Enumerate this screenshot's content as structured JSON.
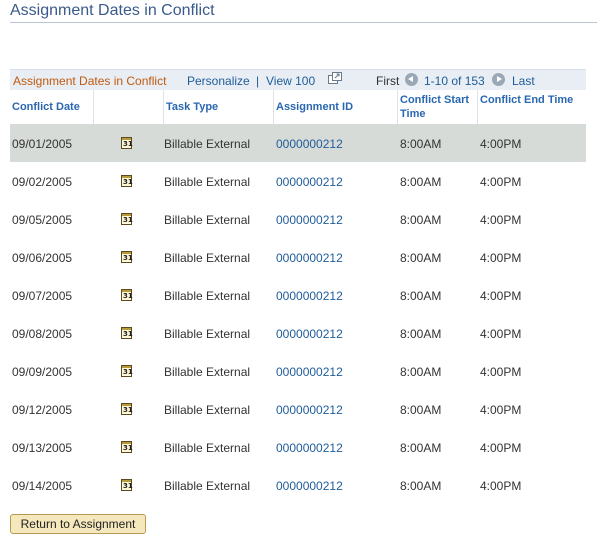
{
  "page": {
    "title": "Assignment Dates in Conflict"
  },
  "grid": {
    "caption": "Assignment Dates in Conflict",
    "personalize": "Personalize",
    "separator": "|",
    "view_all": "View 100",
    "first": "First",
    "range": "1-10 of 153",
    "last": "Last",
    "columns": {
      "conflict_date": "Conflict Date",
      "task_type": "Task Type",
      "assignment_id": "Assignment ID",
      "start_time": "Conflict Start Time",
      "end_time": "Conflict End Time"
    },
    "calendar_glyph": "31",
    "rows": [
      {
        "date": "09/01/2005",
        "task": "Billable External",
        "aid": "0000000212",
        "start": "8:00AM",
        "end": "4:00PM"
      },
      {
        "date": "09/02/2005",
        "task": "Billable External",
        "aid": "0000000212",
        "start": "8:00AM",
        "end": "4:00PM"
      },
      {
        "date": "09/05/2005",
        "task": "Billable External",
        "aid": "0000000212",
        "start": "8:00AM",
        "end": "4:00PM"
      },
      {
        "date": "09/06/2005",
        "task": "Billable External",
        "aid": "0000000212",
        "start": "8:00AM",
        "end": "4:00PM"
      },
      {
        "date": "09/07/2005",
        "task": "Billable External",
        "aid": "0000000212",
        "start": "8:00AM",
        "end": "4:00PM"
      },
      {
        "date": "09/08/2005",
        "task": "Billable External",
        "aid": "0000000212",
        "start": "8:00AM",
        "end": "4:00PM"
      },
      {
        "date": "09/09/2005",
        "task": "Billable External",
        "aid": "0000000212",
        "start": "8:00AM",
        "end": "4:00PM"
      },
      {
        "date": "09/12/2005",
        "task": "Billable External",
        "aid": "0000000212",
        "start": "8:00AM",
        "end": "4:00PM"
      },
      {
        "date": "09/13/2005",
        "task": "Billable External",
        "aid": "0000000212",
        "start": "8:00AM",
        "end": "4:00PM"
      },
      {
        "date": "09/14/2005",
        "task": "Billable External",
        "aid": "0000000212",
        "start": "8:00AM",
        "end": "4:00PM"
      }
    ]
  },
  "buttons": {
    "return": "Return to Assignment"
  },
  "colors": {
    "title": "#3a5a8a",
    "caption": "#c05a10",
    "link": "#1f5c99",
    "selected_row": "#d7dbd8",
    "button_bg": "#f5e8bc"
  },
  "icons": {
    "zoom": "grid-zoom-icon",
    "prev": "previous-arrow-icon",
    "next": "next-arrow-icon",
    "calendar": "calendar-icon"
  }
}
